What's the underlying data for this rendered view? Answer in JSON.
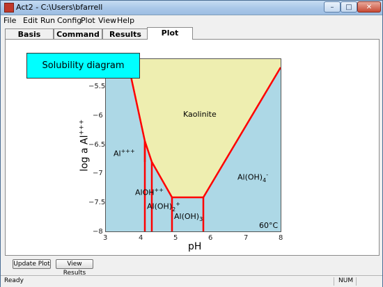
{
  "window": {
    "title": "Act2 - C:\\Users\\bfarrell"
  },
  "titlebar_buttons": {
    "minimize": "–",
    "maximize": "□",
    "close": "✕"
  },
  "menu": [
    "File",
    "Edit",
    "Run",
    "Config",
    "Plot",
    "View",
    "Help"
  ],
  "tabs": [
    {
      "label": "Basis",
      "active": false
    },
    {
      "label": "Command",
      "active": false
    },
    {
      "label": "Results",
      "active": false
    },
    {
      "label": "Plot",
      "active": true
    }
  ],
  "plot": {
    "annotation": "Solubility diagram",
    "temperature": "60°C",
    "xlabel": "pH",
    "ylabel": "log a Al",
    "ylabel_charge": "+++",
    "x_ticks": [
      "3",
      "4",
      "5",
      "6",
      "7",
      "8"
    ],
    "y_ticks": [
      "−5.5",
      "−6",
      "−6.5",
      "−7",
      "−7.5",
      "−8"
    ],
    "regions": {
      "kaolinite": "Kaolinite",
      "al3": "Al",
      "al3_charge": "+++",
      "aloh": "AlOH",
      "aloh_charge": "++",
      "aloh2": "Al(OH)",
      "aloh2_sub": "2",
      "aloh2_charge": "+",
      "aloh3": "Al(OH)",
      "aloh3_sub": "3",
      "aloh4": "Al(OH)",
      "aloh4_sub": "4",
      "aloh4_charge": "-"
    },
    "colors": {
      "fluid": "#add8e6",
      "mineral": "#eeeeb0",
      "boundary": "#ff0000",
      "annotation_box": "#00ffff"
    }
  },
  "buttons": {
    "update_plot": "Update Plot",
    "view_results": "View Results"
  },
  "status": {
    "left": "Ready",
    "num": "NUM"
  }
}
